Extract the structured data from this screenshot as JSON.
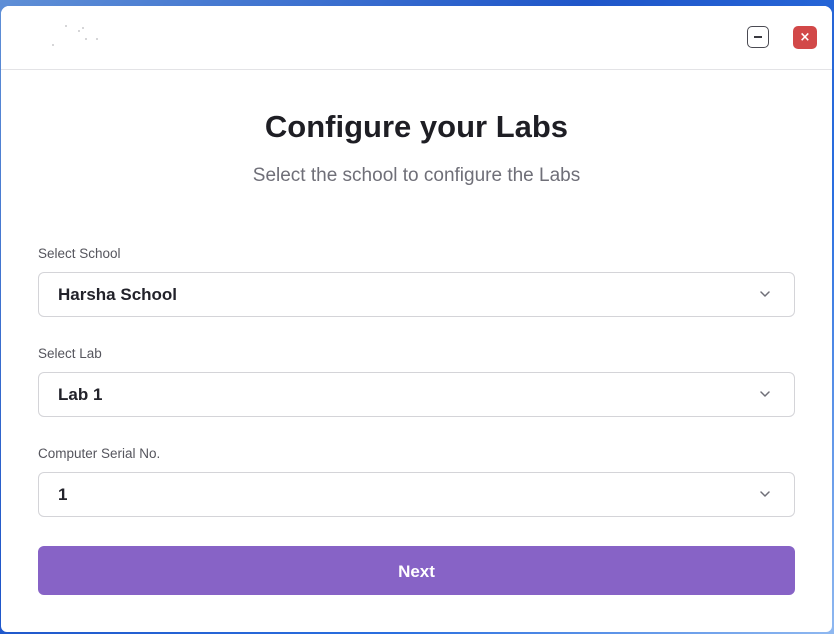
{
  "window": {
    "minimize_icon": "minimize-icon",
    "close_icon": "close-icon",
    "close_glyph": "×"
  },
  "heading": {
    "title": "Configure your Labs",
    "subtitle": "Select the school to configure the Labs"
  },
  "form": {
    "school": {
      "label": "Select School",
      "value": "Harsha School",
      "icon": "chevron-down-icon"
    },
    "lab": {
      "label": "Select Lab",
      "value": "Lab 1",
      "icon": "chevron-down-icon"
    },
    "serial": {
      "label": "Computer Serial No.",
      "value": "1",
      "icon": "chevron-down-icon"
    }
  },
  "actions": {
    "next_label": "Next"
  },
  "colors": {
    "primary": "#8763c6",
    "close_button": "#d24848",
    "title_text": "#1e1e24",
    "subtitle_text": "#6f6f78"
  }
}
